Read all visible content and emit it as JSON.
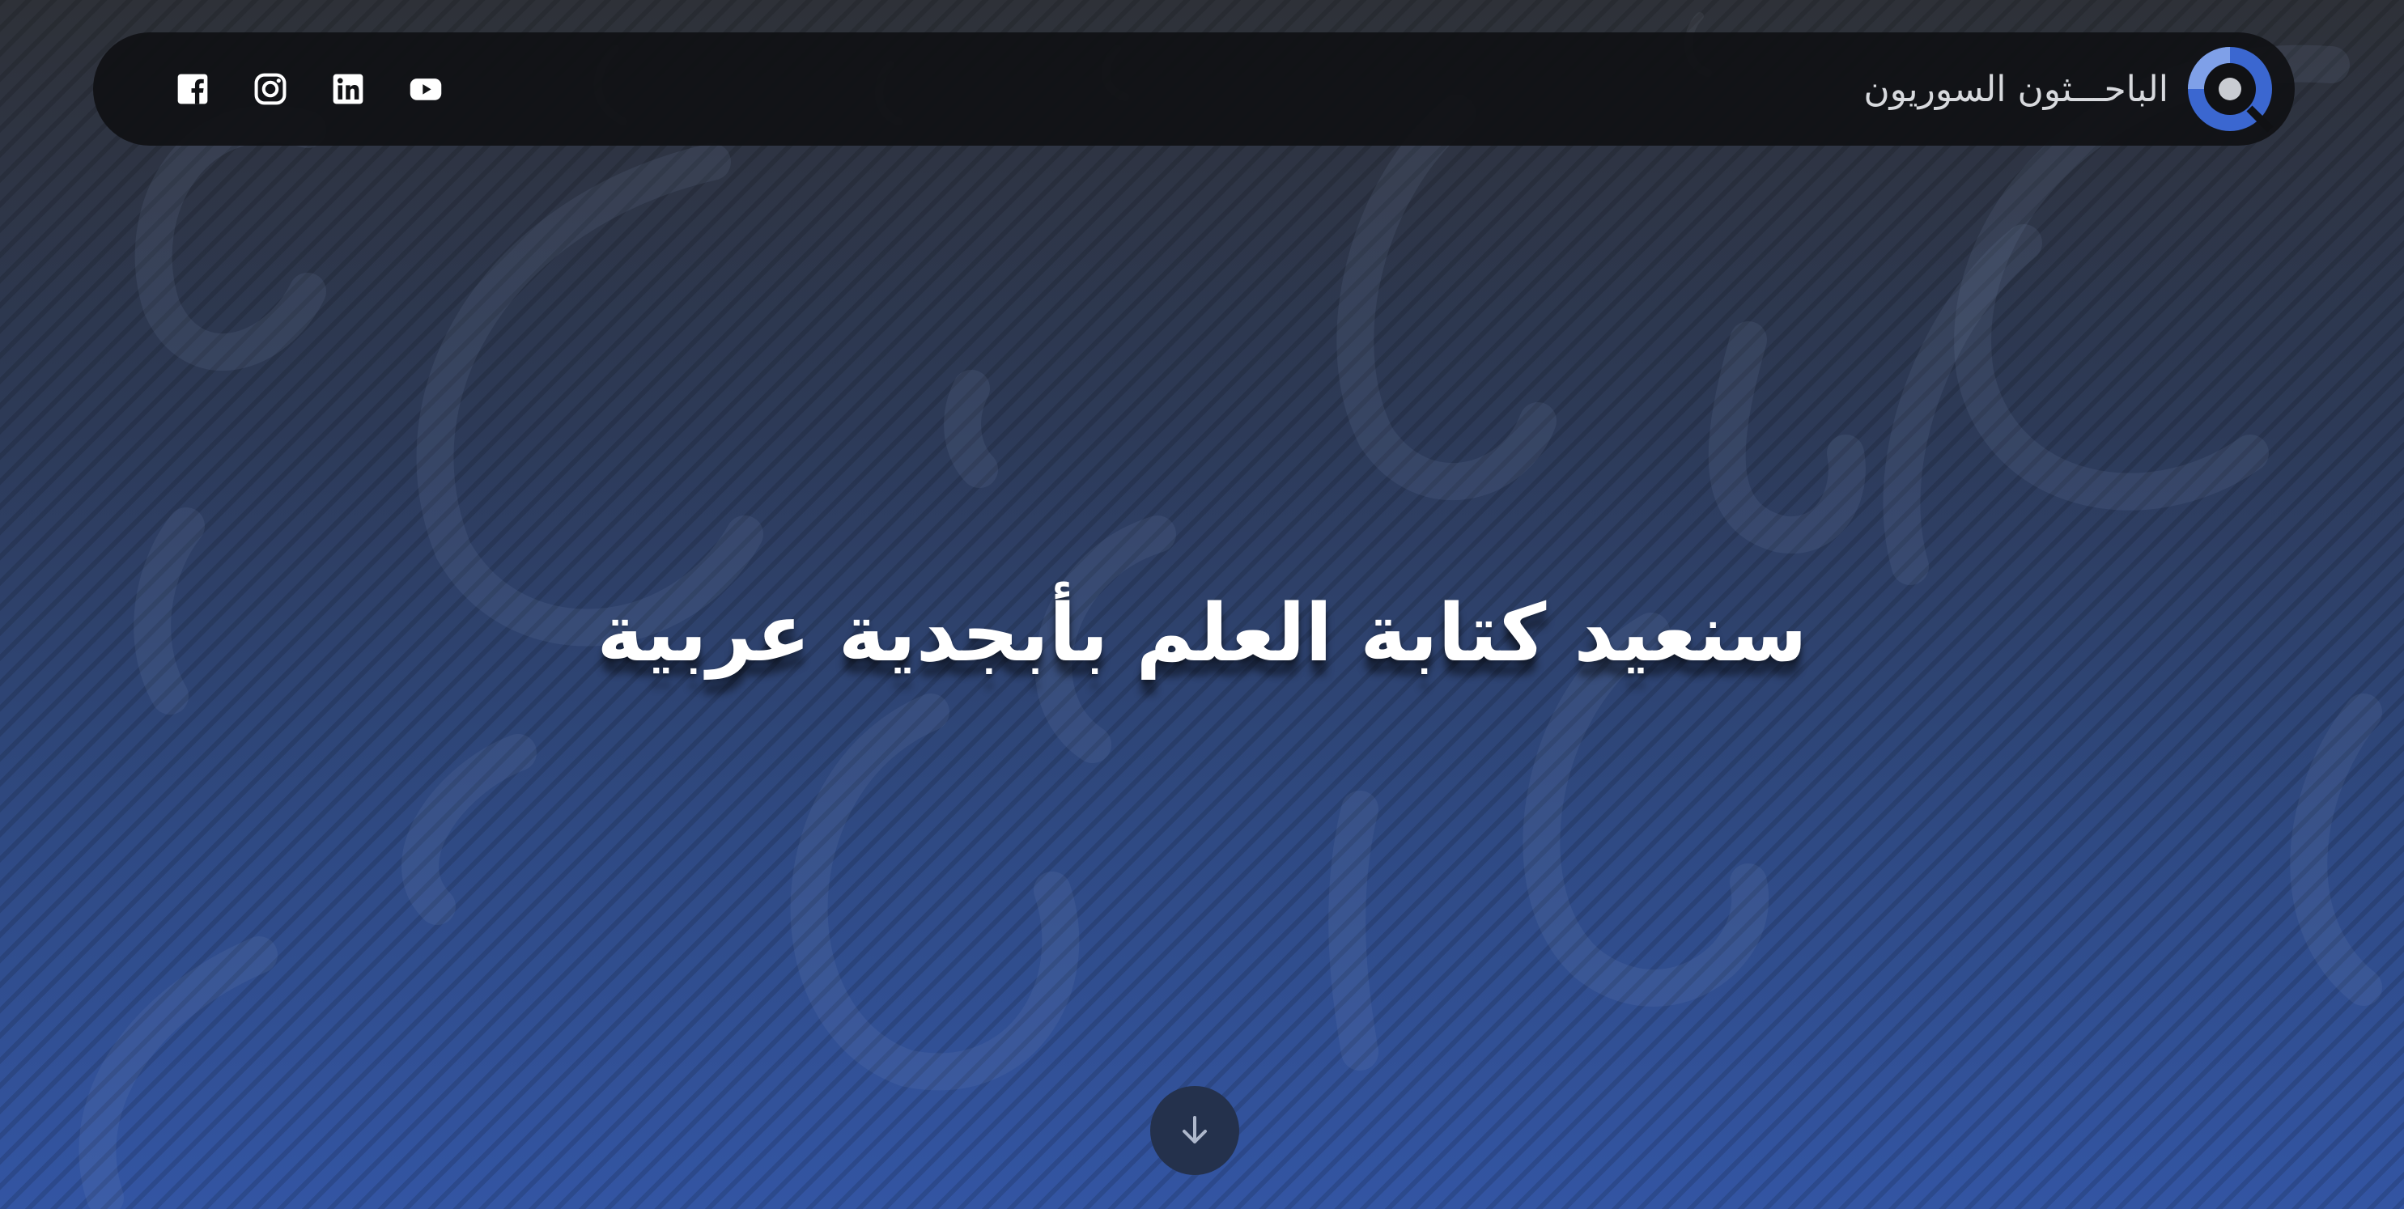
{
  "colors": {
    "navbar_bg": "#101114",
    "accent_blue": "#3b67d0",
    "text_light": "#d7d9dd",
    "headline": "#ffffff",
    "scroll_button_bg": "#24314c"
  },
  "header": {
    "brand_name": "الباحـــثون السوريون",
    "logo_icon": "circular-logo-icon",
    "social_icons": [
      "facebook-icon",
      "instagram-icon",
      "linkedin-icon",
      "youtube-icon"
    ]
  },
  "hero": {
    "headline": "سنعيد كتابة العلم بأبجدية عربية",
    "scroll_icon": "arrow-down-icon"
  }
}
